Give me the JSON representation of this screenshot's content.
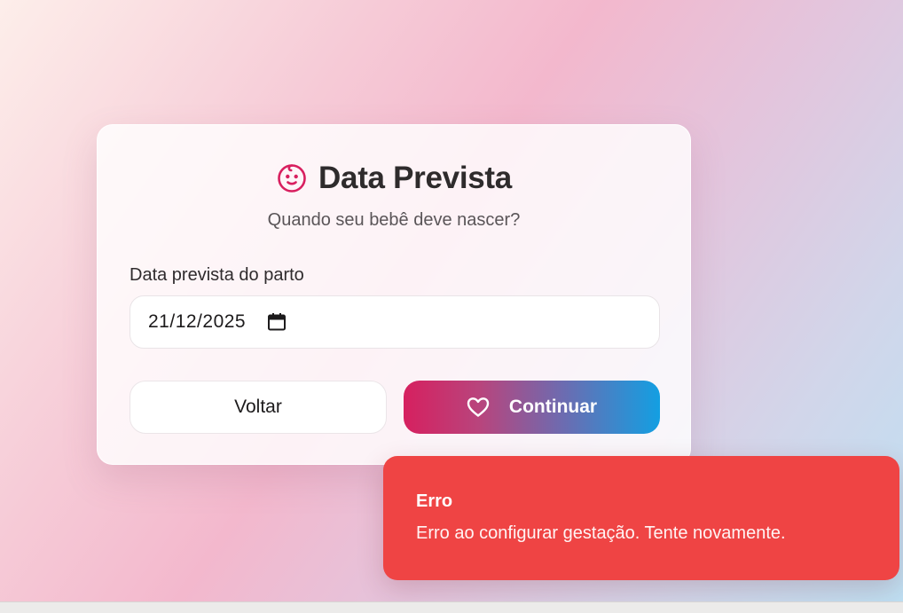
{
  "card": {
    "title": "Data Prevista",
    "subtitle": "Quando seu bebê deve nascer?",
    "icon": "baby-face-icon",
    "field": {
      "label": "Data prevista do parto",
      "value": "21/12/2025",
      "icon": "calendar-icon"
    },
    "buttons": {
      "back_label": "Voltar",
      "continue_label": "Continuar",
      "continue_icon": "heart-icon"
    }
  },
  "toast": {
    "title": "Erro",
    "message": "Erro ao configurar gestação. Tente novamente."
  },
  "colors": {
    "accent_pink": "#d6205f",
    "accent_blue": "#139fe2",
    "error_red": "#ef4444"
  }
}
